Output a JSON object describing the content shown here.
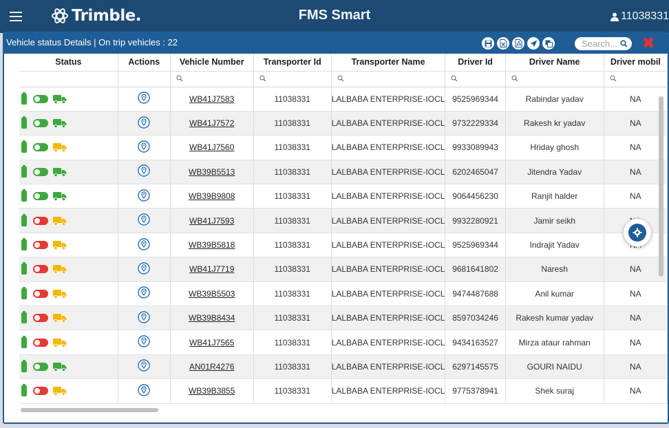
{
  "header": {
    "brand": "Trimble.",
    "app_title": "FMS Smart",
    "user_id": "11038331"
  },
  "modal": {
    "title": "Vehicle status Details | On trip vehicles : 22",
    "search_placeholder": "Search...",
    "close_symbol": "✖",
    "header_icons": [
      "save-icon",
      "excel-icon",
      "pdf-icon",
      "send-icon",
      "copy-icon"
    ]
  },
  "table": {
    "columns": [
      "Status",
      "Actions",
      "Vehicle Number",
      "Transporter Id",
      "Transporter Name",
      "Driver Id",
      "Driver Name",
      "Driver mobil"
    ],
    "rows": [
      {
        "ignition": "on",
        "truck_color": "#3ea83f",
        "vehicle": "WB41J7583",
        "transporter_id": "11038331",
        "transporter_name": "LALBABA ENTERPRISE-IOCL",
        "driver_id": "9525969344",
        "driver_name": "Rabindar yadav",
        "mobile": "NA"
      },
      {
        "ignition": "on",
        "truck_color": "#3ea83f",
        "vehicle": "WB41J7572",
        "transporter_id": "11038331",
        "transporter_name": "LALBABA ENTERPRISE-IOCL",
        "driver_id": "9732229334",
        "driver_name": "Rakesh kr yadav",
        "mobile": "NA"
      },
      {
        "ignition": "on",
        "truck_color": "#f5b800",
        "vehicle": "WB41J7560",
        "transporter_id": "11038331",
        "transporter_name": "LALBABA ENTERPRISE-IOCL",
        "driver_id": "9933089943",
        "driver_name": "Hriday ghosh",
        "mobile": "NA"
      },
      {
        "ignition": "on",
        "truck_color": "#3ea83f",
        "vehicle": "WB39B5513",
        "transporter_id": "11038331",
        "transporter_name": "LALBABA ENTERPRISE-IOCL",
        "driver_id": "6202465047",
        "driver_name": "Jitendra Yadav",
        "mobile": "NA"
      },
      {
        "ignition": "on",
        "truck_color": "#3ea83f",
        "vehicle": "WB39B9808",
        "transporter_id": "11038331",
        "transporter_name": "LALBABA ENTERPRISE-IOCL",
        "driver_id": "9064456230",
        "driver_name": "Ranjit halder",
        "mobile": "NA"
      },
      {
        "ignition": "off",
        "truck_color": "#f5b800",
        "vehicle": "WB41J7593",
        "transporter_id": "11038331",
        "transporter_name": "LALBABA ENTERPRISE-IOCL",
        "driver_id": "9932280921",
        "driver_name": "Jamir seikh",
        "mobile": "NA"
      },
      {
        "ignition": "off",
        "truck_color": "#f5b800",
        "vehicle": "WB39B5818",
        "transporter_id": "11038331",
        "transporter_name": "LALBABA ENTERPRISE-IOCL",
        "driver_id": "9525969344",
        "driver_name": "Indrajit Yadav",
        "mobile": "NA"
      },
      {
        "ignition": "off",
        "truck_color": "#f5b800",
        "vehicle": "WB41J7719",
        "transporter_id": "11038331",
        "transporter_name": "LALBABA ENTERPRISE-IOCL",
        "driver_id": "9681641802",
        "driver_name": "Naresh",
        "mobile": "NA"
      },
      {
        "ignition": "off",
        "truck_color": "#f5b800",
        "vehicle": "WB39B5503",
        "transporter_id": "11038331",
        "transporter_name": "LALBABA ENTERPRISE-IOCL",
        "driver_id": "9474487688",
        "driver_name": "Anil kumar",
        "mobile": "NA"
      },
      {
        "ignition": "off",
        "truck_color": "#f5b800",
        "vehicle": "WB39B8434",
        "transporter_id": "11038331",
        "transporter_name": "LALBABA ENTERPRISE-IOCL",
        "driver_id": "8597034246",
        "driver_name": "Rakesh kumar yadav",
        "mobile": "NA"
      },
      {
        "ignition": "off",
        "truck_color": "#f5b800",
        "vehicle": "WB41J7565",
        "transporter_id": "11038331",
        "transporter_name": "LALBABA ENTERPRISE-IOCL",
        "driver_id": "9434163527",
        "driver_name": "Mirza ataur rahman",
        "mobile": "NA"
      },
      {
        "ignition": "on",
        "truck_color": "#3ea83f",
        "vehicle": "AN01R4276",
        "transporter_id": "11038331",
        "transporter_name": "LALBABA ENTERPRISE-IOCL",
        "driver_id": "6297145575",
        "driver_name": "GOURI NAIDU",
        "mobile": "NA"
      },
      {
        "ignition": "off",
        "truck_color": "#f5b800",
        "vehicle": "WB39B3855",
        "transporter_id": "11038331",
        "transporter_name": "LALBABA ENTERPRISE-IOCL",
        "driver_id": "9775378941",
        "driver_name": "Shek suraj",
        "mobile": "NA"
      }
    ]
  },
  "colors": {
    "topbar": "#1c4a73",
    "modal_header": "#1f5d97",
    "battery": "#3ea83f",
    "toggle_on": "#3ea83f",
    "toggle_off": "#e53935",
    "pin": "#2a6fb5"
  }
}
